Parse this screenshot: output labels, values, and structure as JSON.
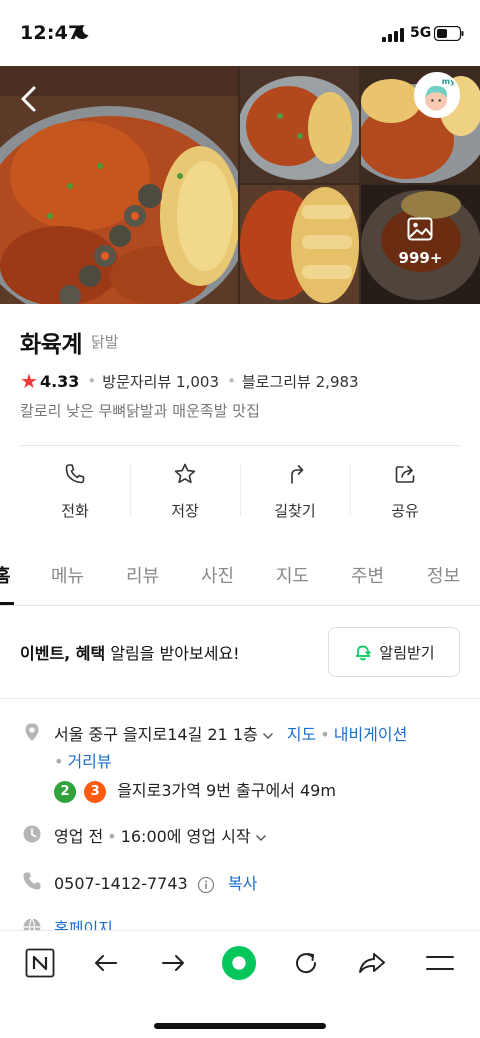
{
  "status_bar": {
    "time": "12:47",
    "network": "5G"
  },
  "photos": {
    "more_count": "999+",
    "avatar_label": "my"
  },
  "place": {
    "name": "화육계",
    "category": "닭발",
    "rating": "4.33",
    "visitor_reviews": "방문자리뷰 1,003",
    "blog_reviews": "블로그리뷰 2,983",
    "description": "칼로리 낮은 무뼈닭발과 매운족발 맛집"
  },
  "actions": [
    {
      "label": "전화",
      "icon": "phone-icon"
    },
    {
      "label": "저장",
      "icon": "star-icon"
    },
    {
      "label": "길찾기",
      "icon": "directions-icon"
    },
    {
      "label": "공유",
      "icon": "share-icon"
    }
  ],
  "tabs": [
    {
      "label": "홈",
      "active": true
    },
    {
      "label": "메뉴"
    },
    {
      "label": "리뷰"
    },
    {
      "label": "사진"
    },
    {
      "label": "지도"
    },
    {
      "label": "주변"
    },
    {
      "label": "정보"
    }
  ],
  "event": {
    "bold": "이벤트, 혜택",
    "rest": " 알림을 받아보세요!",
    "button": "알림받기"
  },
  "info": {
    "address": "서울 중구 을지로14길 21 1층",
    "map_link": "지도",
    "nav_link": "내비게이션",
    "street_link": "거리뷰",
    "subway_lines": [
      "2",
      "3"
    ],
    "subway_text": "을지로3가역 9번 출구에서 49m",
    "hours_status": "영업 전",
    "hours_text": "16:00에 영업 시작",
    "phone": "0507-1412-7743",
    "copy": "복사",
    "homepage": "홈페이지"
  },
  "colors": {
    "accent_green": "#03c75a",
    "link_blue": "#1a6fd1",
    "star_red": "#f03a3a",
    "line2": "#33a23d",
    "line3": "#fe5b10"
  }
}
